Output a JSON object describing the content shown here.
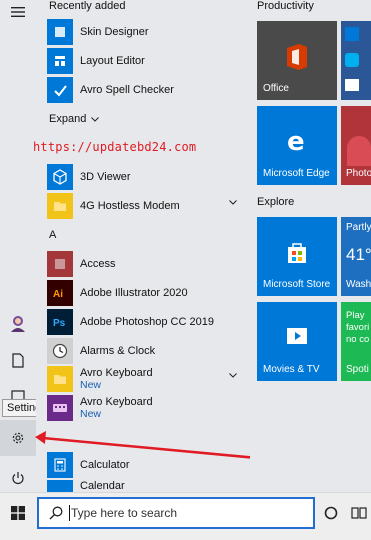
{
  "rail": {
    "tooltip": "Settings"
  },
  "applist": {
    "recently_added": "Recently added",
    "recent": [
      {
        "label": "Skin Designer"
      },
      {
        "label": "Layout Editor"
      },
      {
        "label": "Avro Spell Checker"
      }
    ],
    "expand": "Expand",
    "watermark": "https://updatebd24.com",
    "apps_top": [
      {
        "label": "3D Viewer"
      },
      {
        "label": "4G Hostless Modem"
      }
    ],
    "letter_a": "A",
    "apps_a": [
      {
        "label": "Access"
      },
      {
        "label": "Adobe Illustrator 2020"
      },
      {
        "label": "Adobe Photoshop CC 2019"
      },
      {
        "label": "Alarms & Clock"
      },
      {
        "label": "Avro Keyboard",
        "sub": "New"
      },
      {
        "label": "Avro Keyboard",
        "sub": "New"
      }
    ],
    "apps_c": [
      {
        "label": "Calculator"
      },
      {
        "label": "Calendar"
      }
    ]
  },
  "tiles": {
    "productivity": "Productivity",
    "office": "Office",
    "edge": "Microsoft Edge",
    "photos": "Photo",
    "explore": "Explore",
    "store": "Microsoft Store",
    "weather_top": "Partly",
    "weather_temp": "41°",
    "weather_loc": "Washi",
    "movies": "Movies & TV",
    "spotify_line1": "Play",
    "spotify_line2": "favori",
    "spotify_line3": "no co",
    "spotify": "Spoti"
  },
  "taskbar": {
    "search_placeholder": "Type here to search"
  },
  "colors": {
    "accent": "#0078d7",
    "office": "#d83b01",
    "arrow": "#e01b24",
    "spotify": "#1db954"
  }
}
